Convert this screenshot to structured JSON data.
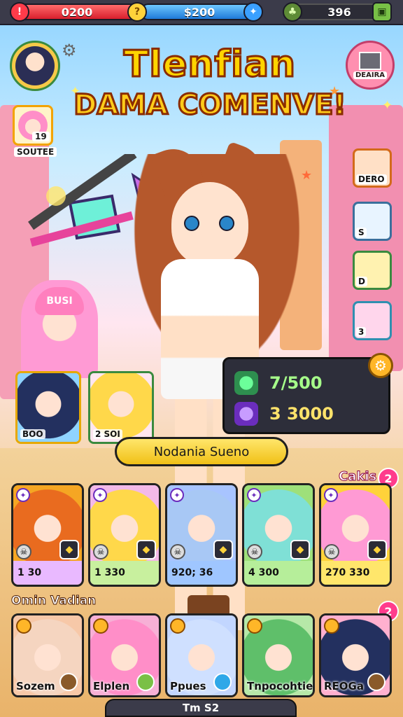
{
  "top_bar": {
    "health_value": "0200",
    "coins_value": "$200",
    "gems_value": "396"
  },
  "title": {
    "line1": "Tlenfian",
    "line2": "DAMA COMENVE!"
  },
  "left_side": {
    "card_label": "SOUTEE",
    "card_number": "19"
  },
  "right_side": {
    "button_label": "DEAIRA",
    "cards": [
      {
        "label": "DERO"
      },
      {
        "label": "S"
      },
      {
        "label": "D"
      },
      {
        "label": "3"
      }
    ]
  },
  "banner_text": "BUSI",
  "mini_cards": [
    {
      "label": "BOO"
    },
    {
      "label": "2 SOI"
    }
  ],
  "stats": {
    "row1": "7/500",
    "row2": "3 3000"
  },
  "name_banner": "Nodania Sueno",
  "cakis": {
    "label": "Cakis",
    "badge": "2"
  },
  "row1_cards": [
    {
      "stat": "1  30",
      "bg": "#f5a623",
      "hair": "#e96b1f"
    },
    {
      "stat": "1  330",
      "bg": "#f3b9e8",
      "hair": "#ffd84a"
    },
    {
      "stat": "920; 36",
      "bg": "#a8c4ff",
      "hair": "#a8c8f5"
    },
    {
      "stat": "4   300",
      "bg": "#9ee07a",
      "hair": "#7fe0d6"
    },
    {
      "stat": "270 330",
      "bg": "#ffd23a",
      "hair": "#ff9ad4"
    }
  ],
  "section_title": "Omin Vadian",
  "row2_cards": [
    {
      "name": "Sozem",
      "bg": "#f7c8a8",
      "hair": "#f5d5c0"
    },
    {
      "name": "Elplen",
      "bg": "#f7b0d6",
      "hair": "#ff8ec8"
    },
    {
      "name": "Ppues",
      "bg": "#c2d6ff",
      "hair": "#cfe0ff"
    },
    {
      "name": "Tnpocohtien",
      "bg": "#b6e8a8",
      "hair": "#5fbf6a"
    },
    {
      "name": "REOGa",
      "bg": "#ffb0cf",
      "hair": "#23305f"
    }
  ],
  "row2_badge": "2",
  "bottom_bar": "Tm S2"
}
